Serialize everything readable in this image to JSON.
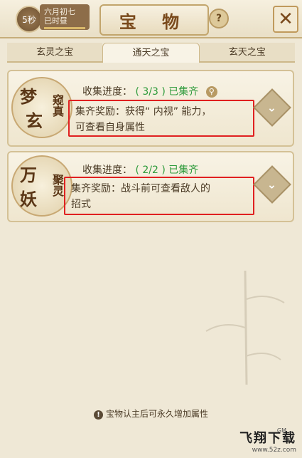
{
  "header": {
    "timer": "5秒",
    "date_line1": "六月初七",
    "date_line2": "已时昼",
    "title": "宝 物",
    "help_label": "?",
    "close_label": "✕"
  },
  "tabs": [
    "玄灵之宝",
    "通天之宝",
    "玄天之宝"
  ],
  "cards": [
    {
      "emblem_main": [
        "梦",
        "玄"
      ],
      "emblem_side": "窥真",
      "progress_label": "收集进度：",
      "progress_value": "( 3/3 )",
      "progress_status": "已集齐",
      "reward_line1": "集齐奖励：获得“ 内视” 能力，",
      "reward_line2": "可查看自身属性"
    },
    {
      "emblem_main": [
        "万",
        "妖"
      ],
      "emblem_side": "聚灵",
      "progress_label": "收集进度：",
      "progress_value": "( 2/2 )",
      "progress_status": "已集齐",
      "reward_line1": "集齐奖励：战斗前可查看敌人的",
      "reward_line2": "招式"
    }
  ],
  "footer": {
    "note": "宝物认主后可永久增加属性",
    "gm": "GM"
  },
  "watermark": {
    "main": "飞翔下载",
    "sub": "www.52z.com"
  },
  "colors": {
    "accent_green": "#2c9a3a",
    "highlight_red": "#e02020",
    "title_brown": "#7a4a1c"
  }
}
